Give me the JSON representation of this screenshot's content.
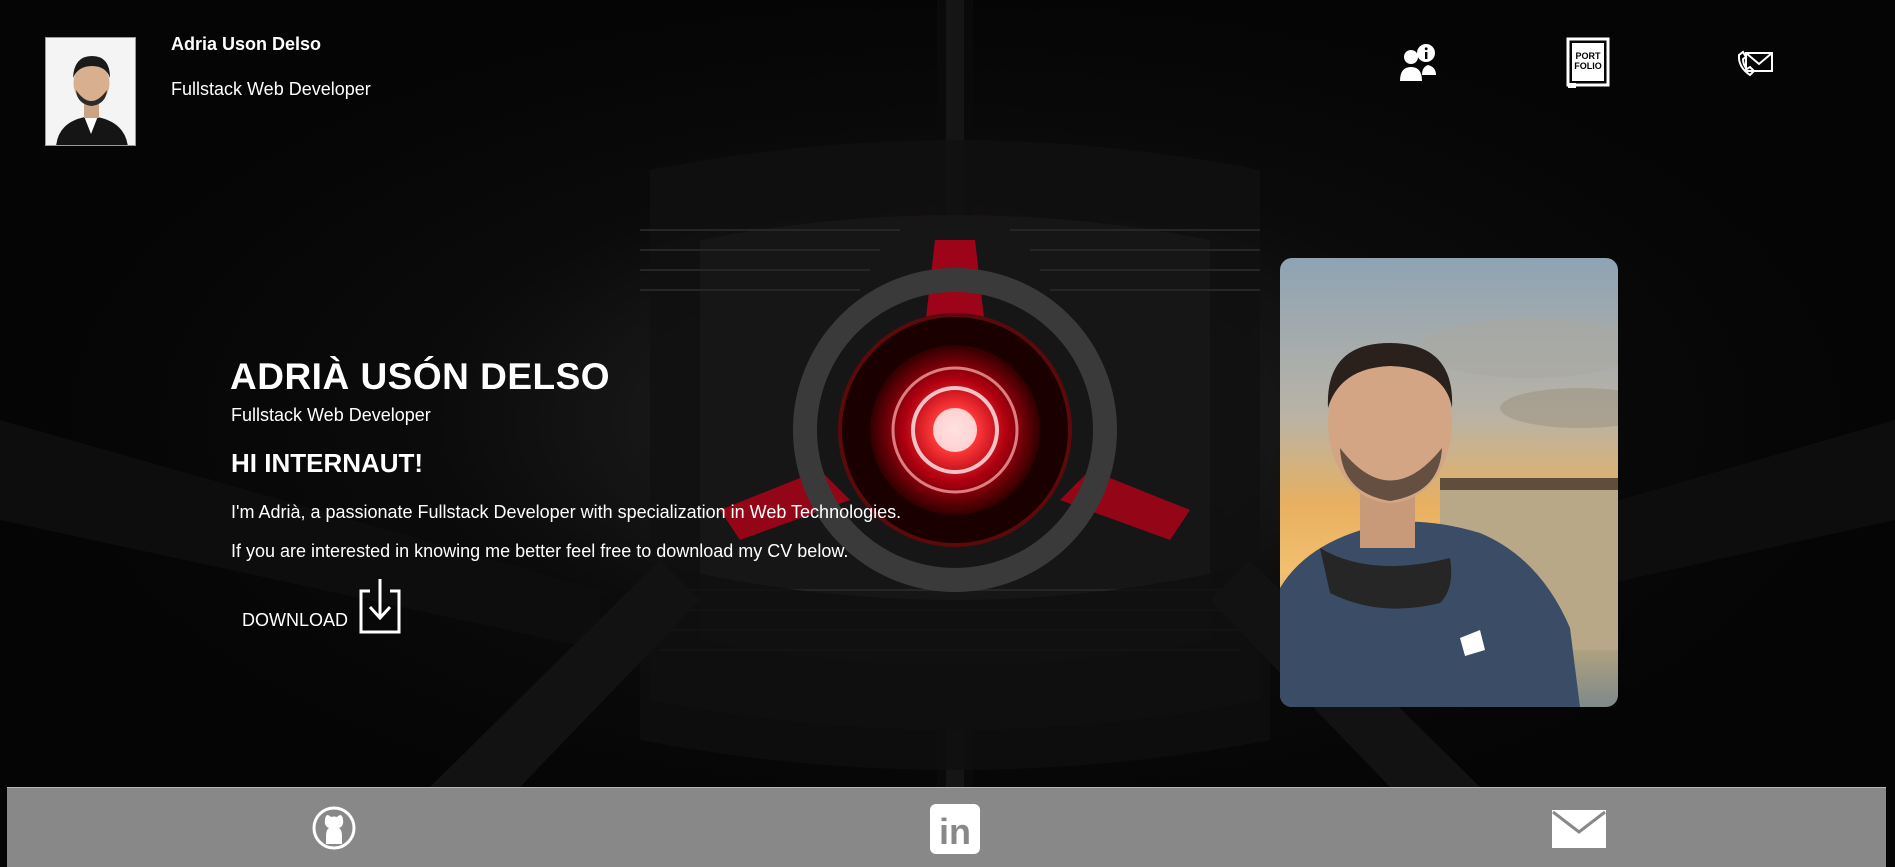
{
  "header": {
    "name": "Adria Uson Delso",
    "role": "Fullstack Web Developer",
    "nav_icons": [
      "about-me-icon",
      "portfolio-icon",
      "contact-phone-mail-icon"
    ],
    "portfolio_icon_text": [
      "PORT",
      "FOLIO"
    ]
  },
  "hero": {
    "title": "ADRIÀ USÓN DELSO",
    "subtitle": "Fullstack Web Developer",
    "greeting": "HI INTERNAUT!",
    "paragraph_1": "I'm Adrià, a passionate Fullstack Developer with specialization in Web Technologies.",
    "paragraph_2": "If you are interested in knowing me better feel free to download my CV below.",
    "download_label": "DOWNLOAD"
  },
  "footer": {
    "icons": [
      "github-icon",
      "linkedin-icon",
      "mail-icon"
    ],
    "linkedin_text": "in"
  },
  "colors": {
    "footer_bg": "#888888",
    "accent_red": "#e0101e",
    "footer_border": "#d9b36a"
  }
}
